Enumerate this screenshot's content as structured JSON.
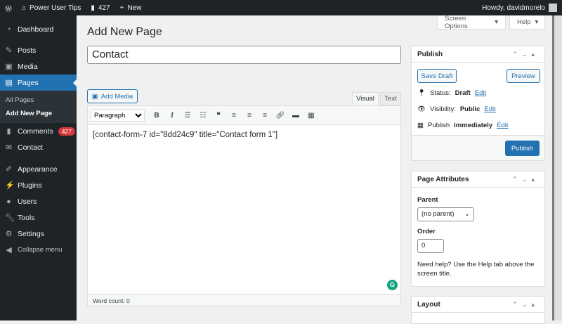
{
  "adminbar": {
    "site": "Power User Tips",
    "comments": "427",
    "new": "New",
    "howdy": "Howdy, davidmorelo"
  },
  "menu": {
    "items": [
      {
        "label": "Dashboard",
        "icon": "dashboard-icon"
      },
      {
        "label": "Posts",
        "icon": "pin-icon"
      },
      {
        "label": "Media",
        "icon": "media-icon"
      },
      {
        "label": "Pages",
        "icon": "pages-icon"
      }
    ],
    "sub": [
      "All Pages",
      "Add New Page"
    ],
    "items2": [
      {
        "label": "Comments",
        "icon": "comment-icon",
        "badge": "427"
      },
      {
        "label": "Contact",
        "icon": "mail-icon"
      },
      {
        "label": "Appearance",
        "icon": "brush-icon"
      },
      {
        "label": "Plugins",
        "icon": "plugin-icon"
      },
      {
        "label": "Users",
        "icon": "user-icon"
      },
      {
        "label": "Tools",
        "icon": "wrench-icon"
      },
      {
        "label": "Settings",
        "icon": "settings-icon"
      },
      {
        "label": "Collapse menu",
        "icon": "collapse-icon"
      }
    ]
  },
  "page": {
    "title": "Add New Page",
    "screen_options": "Screen Options",
    "help": "Help",
    "post_title": "Contact"
  },
  "editor": {
    "add_media": "Add Media",
    "tab_visual": "Visual",
    "tab_text": "Text",
    "format": "Paragraph",
    "content": "[contact-form-7 id=\"8dd24c9\" title=\"Contact form 1\"]",
    "word_count": "Word count: 0"
  },
  "publish": {
    "title": "Publish",
    "save_draft": "Save Draft",
    "preview": "Preview",
    "status_label": "Status:",
    "status": "Draft",
    "visibility_label": "Visibility:",
    "visibility": "Public",
    "publish_label": "Publish",
    "publish_when": "immediately",
    "edit": "Edit",
    "publish_btn": "Publish"
  },
  "attributes": {
    "title": "Page Attributes",
    "parent_label": "Parent",
    "parent": "(no parent)",
    "order_label": "Order",
    "order": "0",
    "help": "Need help? Use the Help tab above the screen title."
  },
  "layout": {
    "title": "Layout"
  }
}
